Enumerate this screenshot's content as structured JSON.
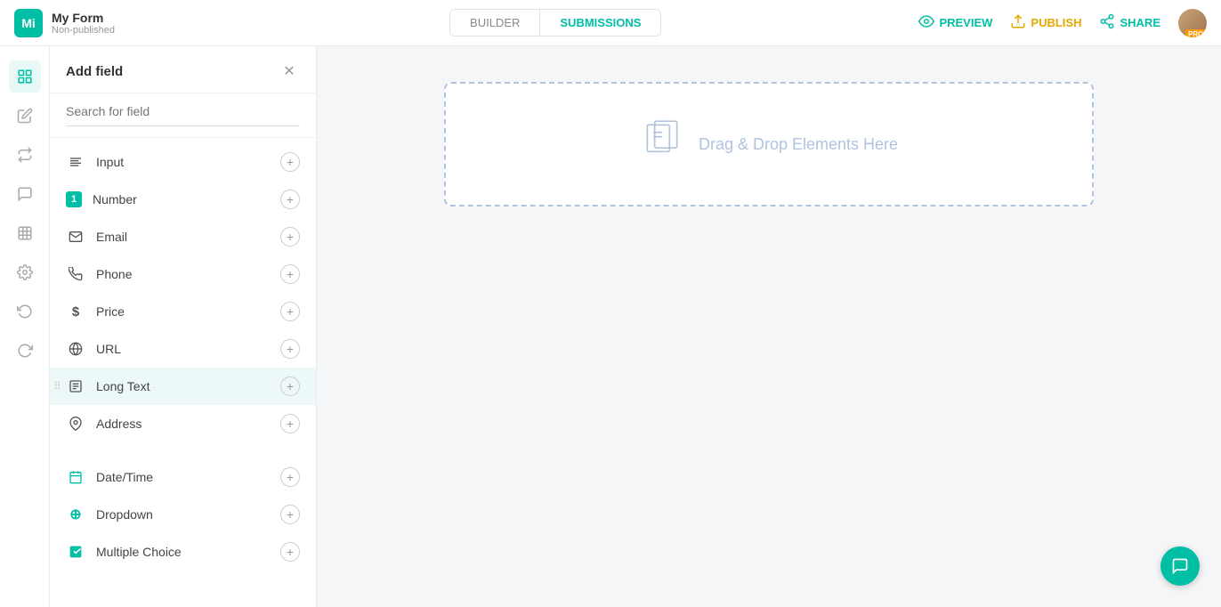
{
  "app": {
    "logo_text": "Mi",
    "form_title": "My Form",
    "form_status": "Non-published"
  },
  "nav": {
    "tab_builder": "BUILDER",
    "tab_submissions": "SUBMISSIONS",
    "active_tab": "submissions",
    "preview_label": "PREVIEW",
    "publish_label": "PUBLISH",
    "share_label": "SHARE"
  },
  "panel": {
    "title": "Add field",
    "search_placeholder": "Search for field",
    "fields": [
      {
        "id": "input",
        "label": "Input",
        "icon": "T",
        "icon_type": "text"
      },
      {
        "id": "number",
        "label": "Number",
        "icon": "1",
        "icon_type": "badge"
      },
      {
        "id": "email",
        "label": "Email",
        "icon": "✉",
        "icon_type": "text"
      },
      {
        "id": "phone",
        "label": "Phone",
        "icon": "📞",
        "icon_type": "text"
      },
      {
        "id": "price",
        "label": "Price",
        "icon": "$",
        "icon_type": "text"
      },
      {
        "id": "url",
        "label": "URL",
        "icon": "🌐",
        "icon_type": "text"
      },
      {
        "id": "longtext",
        "label": "Long Text",
        "icon": "▭",
        "icon_type": "text"
      },
      {
        "id": "address",
        "label": "Address",
        "icon": "📍",
        "icon_type": "text"
      },
      {
        "id": "datetime",
        "label": "Date/Time",
        "icon": "📅",
        "icon_type": "teal"
      },
      {
        "id": "dropdown",
        "label": "Dropdown",
        "icon": "⊕",
        "icon_type": "teal"
      },
      {
        "id": "multiplechoice",
        "label": "Multiple Choice",
        "icon": "☑",
        "icon_type": "teal"
      }
    ]
  },
  "dropzone": {
    "text": "Drag & Drop Elements Here"
  },
  "sidebar_icons": [
    {
      "id": "fields",
      "icon": "⊞",
      "active": true
    },
    {
      "id": "edit",
      "icon": "✎",
      "active": false
    },
    {
      "id": "arrows",
      "icon": "⇄",
      "active": false
    },
    {
      "id": "chat",
      "icon": "💬",
      "active": false
    },
    {
      "id": "grid",
      "icon": "⊞",
      "active": false
    },
    {
      "id": "settings",
      "icon": "⚙",
      "active": false
    },
    {
      "id": "undo",
      "icon": "↺",
      "active": false
    },
    {
      "id": "redo",
      "icon": "↻",
      "active": false
    }
  ]
}
